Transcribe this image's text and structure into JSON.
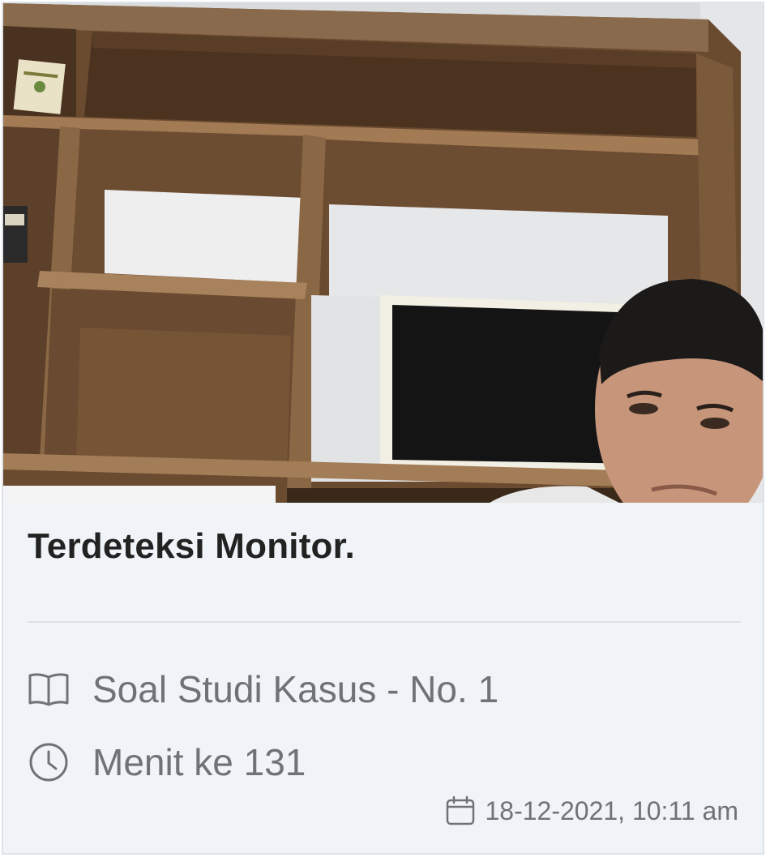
{
  "card": {
    "title": "Terdeteksi Monitor.",
    "question": {
      "icon": "book-icon",
      "label": "Soal Studi Kasus - No. 1"
    },
    "minute": {
      "icon": "clock-icon",
      "label": "Menit ke 131"
    },
    "timestamp": {
      "icon": "calendar-icon",
      "label": "18-12-2021, 10:11 am"
    }
  },
  "colors": {
    "card_background": "#f0f3f7",
    "title_text": "#222222",
    "meta_text": "#6f7378",
    "divider": "#dde1e6"
  }
}
